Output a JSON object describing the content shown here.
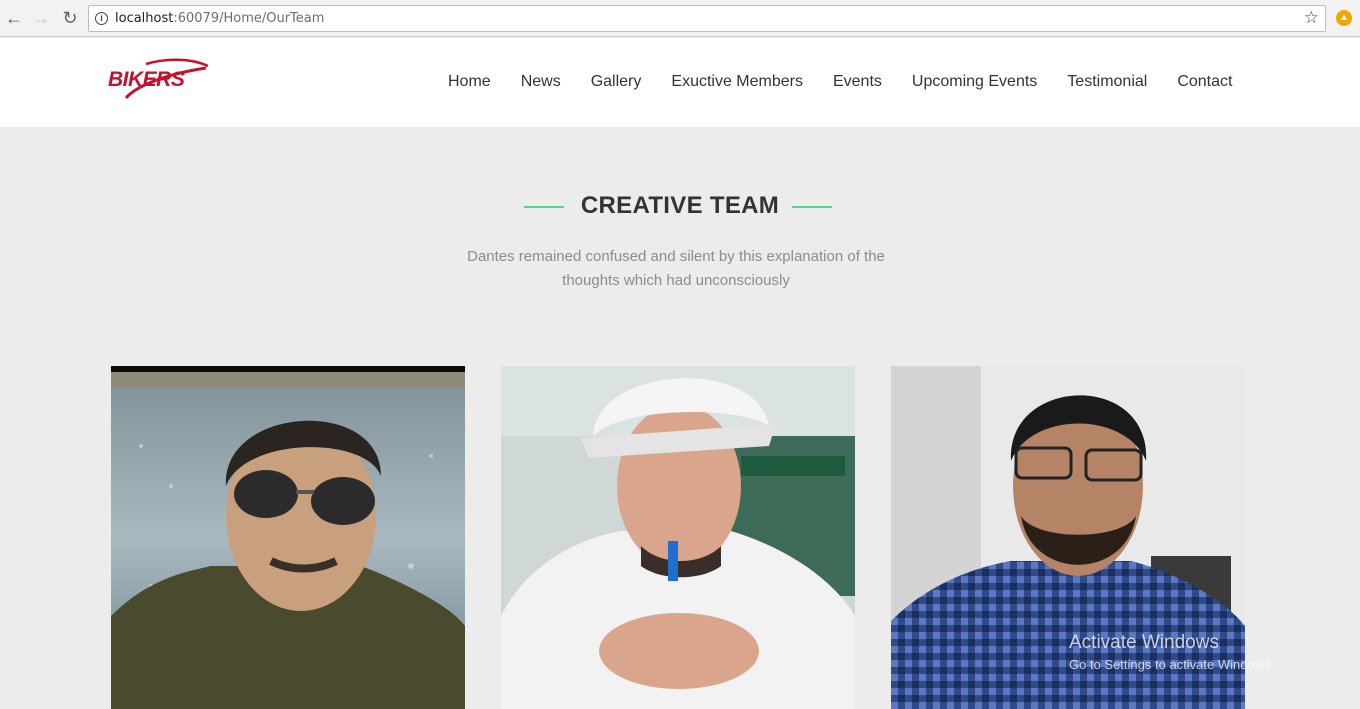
{
  "browser": {
    "url_host": "localhost",
    "url_rest": ":60079/Home/OurTeam"
  },
  "site": {
    "logo_text": "BIKERS",
    "brand_color": "#c8102e",
    "nav": [
      {
        "label": "Home"
      },
      {
        "label": "News"
      },
      {
        "label": "Gallery"
      },
      {
        "label": "Exuctive Members"
      },
      {
        "label": "Events"
      },
      {
        "label": "Upcoming Events"
      },
      {
        "label": "Testimonial"
      },
      {
        "label": "Contact"
      }
    ]
  },
  "section": {
    "title": "CREATIVE TEAM",
    "accent_color": "#5fcf8f",
    "subtitle_line1": "Dantes remained confused and silent by this explanation of the",
    "subtitle_line2": "thoughts which had unconsciously"
  },
  "team": [
    {
      "photo": "man-with-sunglasses-by-river"
    },
    {
      "photo": "man-with-white-cap"
    },
    {
      "photo": "man-with-glasses-checked-shirt"
    }
  ],
  "watermark": {
    "line1": "Activate Windows",
    "line2": "Go to Settings to activate Windows."
  }
}
